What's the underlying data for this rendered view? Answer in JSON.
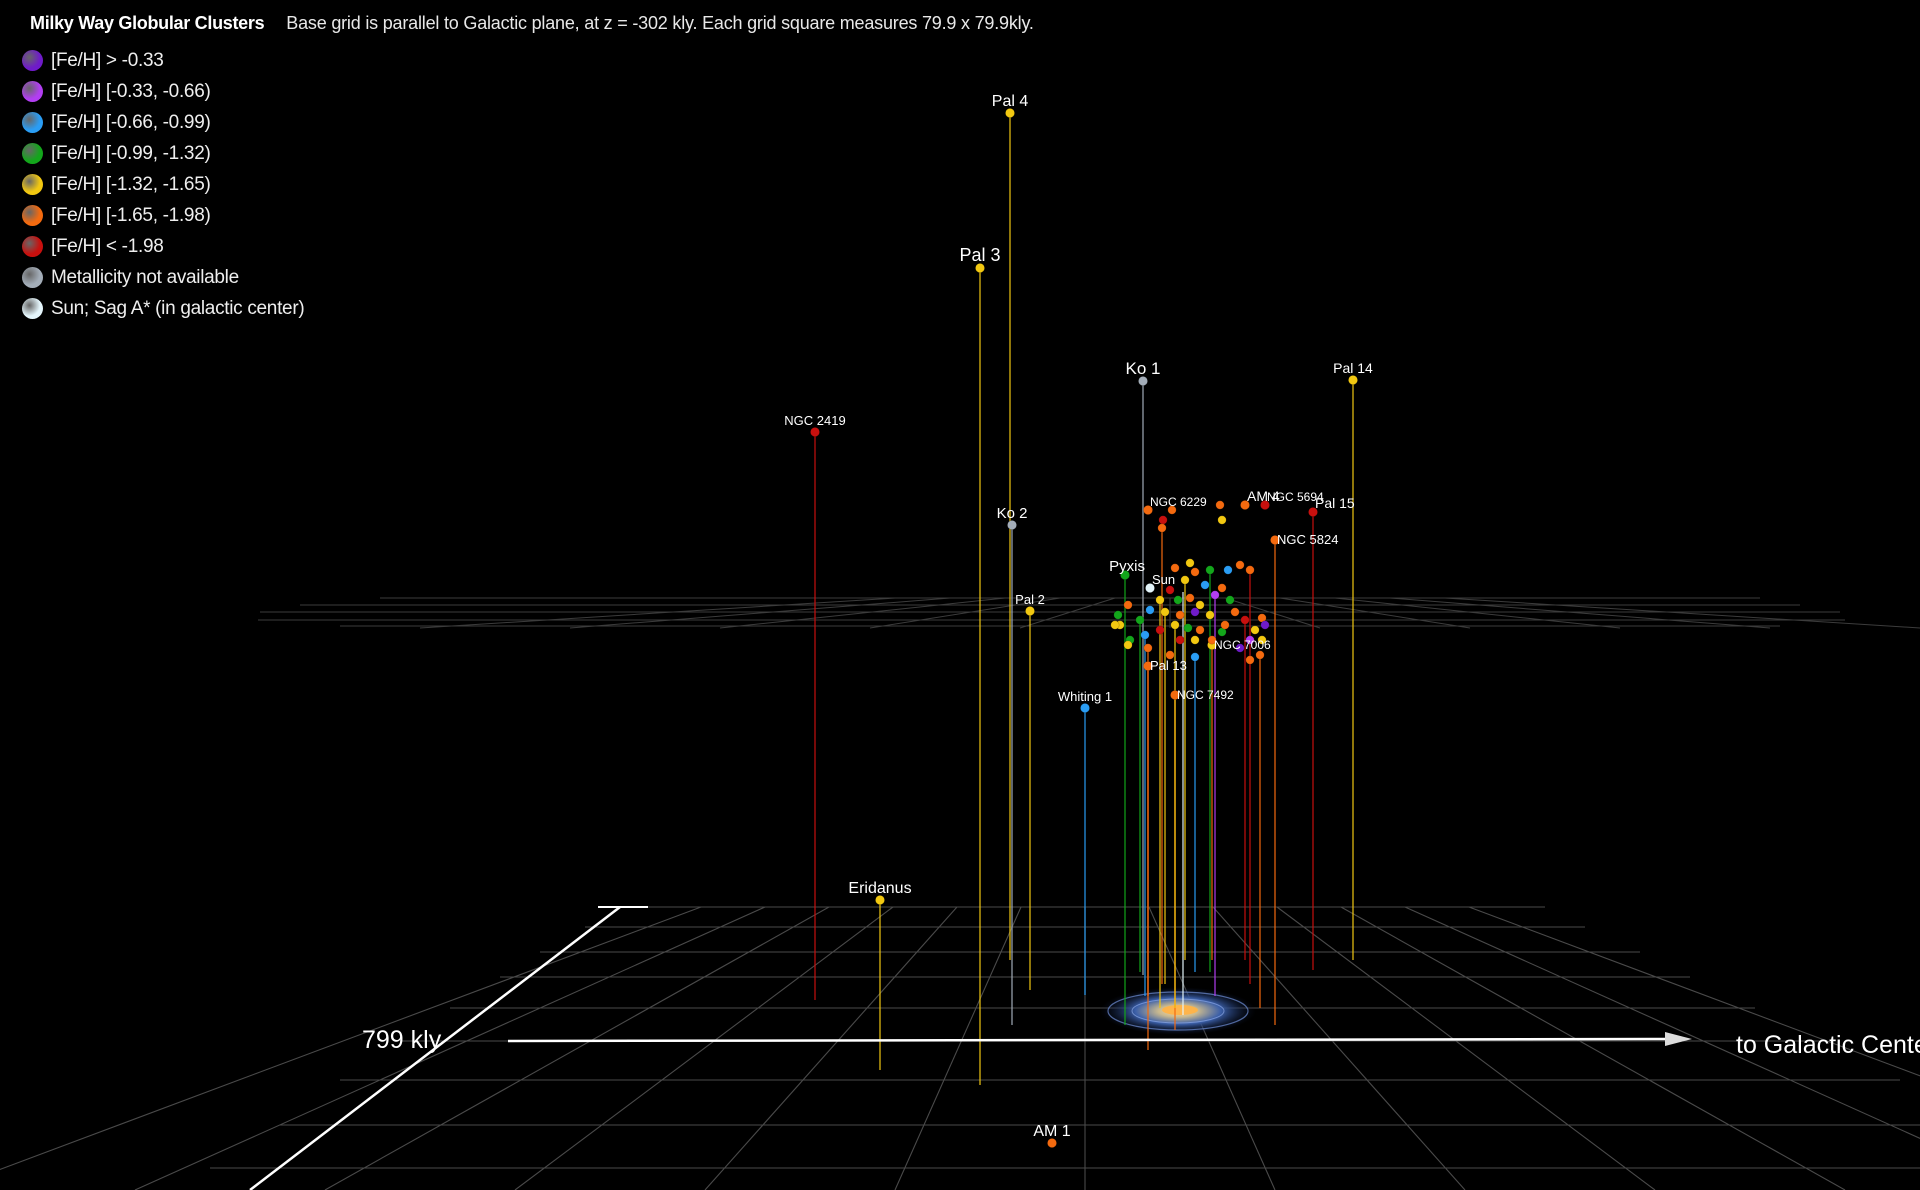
{
  "title": "Milky Way Globular Clusters",
  "subtitle": "Base grid is parallel to Galactic plane, at z = -302 kly. Each grid square measures 79.9 x 79.9kly.",
  "legend": [
    {
      "label": "[Fe/H] > -0.33",
      "color": "#6f1bc9"
    },
    {
      "label": "[Fe/H] [-0.33, -0.66)",
      "color": "#b23ef2"
    },
    {
      "label": "[Fe/H] [-0.66, -0.99)",
      "color": "#2a9df4"
    },
    {
      "label": "[Fe/H] [-0.99, -1.32)",
      "color": "#13a61b"
    },
    {
      "label": "[Fe/H] [-1.32, -1.65)",
      "color": "#f2c811"
    },
    {
      "label": "[Fe/H] [-1.65, -1.98)",
      "color": "#f46a0f"
    },
    {
      "label": "[Fe/H] < -1.98",
      "color": "#c8100e"
    },
    {
      "label": "Metallicity not available",
      "color": "#a3adb8"
    },
    {
      "label": "Sun; Sag A* (in galactic center)",
      "color": "#e4f5fb"
    }
  ],
  "axes": {
    "depth_label": "799 kly",
    "x_label": "to Galactic Center"
  },
  "chart_data": {
    "type": "scatter",
    "title": "Milky Way Globular Clusters",
    "projection": "3d perspective",
    "grid_square_kly": 79.9,
    "base_grid_z_kly": -302,
    "labeled_clusters": [
      {
        "name": "Pal 4",
        "category": "[Fe/H] [-1.32, -1.65)"
      },
      {
        "name": "Pal 3",
        "category": "[Fe/H] [-1.32, -1.65)"
      },
      {
        "name": "Ko 1",
        "category": "Metallicity not available"
      },
      {
        "name": "Pal 14",
        "category": "[Fe/H] [-1.32, -1.65)"
      },
      {
        "name": "NGC 2419",
        "category": "[Fe/H] < -1.98"
      },
      {
        "name": "Ko 2",
        "category": "Metallicity not available"
      },
      {
        "name": "NGC 6229",
        "category": "[Fe/H] [-1.65, -1.98)"
      },
      {
        "name": "AM 4",
        "category": "[Fe/H] [-1.65, -1.98)"
      },
      {
        "name": "NGC 5694",
        "category": "[Fe/H] < -1.98"
      },
      {
        "name": "Pal 15",
        "category": "[Fe/H] < -1.98"
      },
      {
        "name": "NGC 5824",
        "category": "[Fe/H] [-1.65, -1.98)"
      },
      {
        "name": "Pyxis",
        "category": "[Fe/H] [-0.99, -1.32)"
      },
      {
        "name": "Sun",
        "category": "Sun; Sag A* (in galactic center)"
      },
      {
        "name": "Pal 2",
        "category": "[Fe/H] [-1.32, -1.65)"
      },
      {
        "name": "NGC 7006",
        "category": "[Fe/H] [-1.32, -1.65)"
      },
      {
        "name": "Pal 13",
        "category": "[Fe/H] [-1.65, -1.98)"
      },
      {
        "name": "NGC 7492",
        "category": "[Fe/H] [-1.65, -1.98)"
      },
      {
        "name": "Whiting 1",
        "category": "[Fe/H] [-0.66, -0.99)"
      },
      {
        "name": "Eridanus",
        "category": "[Fe/H] [-1.32, -1.65)"
      },
      {
        "name": "AM 1",
        "category": "[Fe/H] [-1.65, -1.98)"
      }
    ]
  }
}
